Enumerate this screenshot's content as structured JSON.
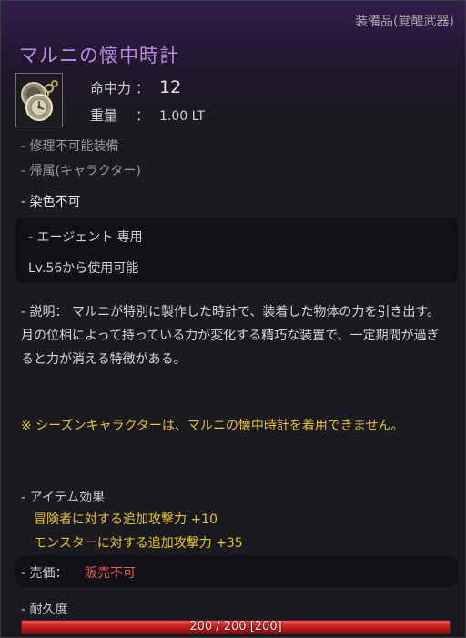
{
  "header": {
    "category": "装備品(覚醒武器)",
    "title": "マルニの懐中時計"
  },
  "icon": {
    "name": "pocket-watch-icon"
  },
  "stats": [
    {
      "label": "命中力",
      "colon": "：",
      "value": "12"
    },
    {
      "label": "重量",
      "colon": "：",
      "value": "1.00 LT"
    }
  ],
  "properties": [
    "- 修理不可能装備",
    "- 帰属(キャラクター)",
    "- 染色不可"
  ],
  "restriction": {
    "class": "- エージェント 専用",
    "level": "Lv.56から使用可能"
  },
  "description": "- 説明： マルニが特別に製作した時計で、装着した物体の力を引き出す。月の位相によって持っている力が変化する精巧な装置で、一定期間が過ぎると力が消える特徴がある。",
  "note": "※ シーズンキャラクターは、マルニの懐中時計を着用できません。",
  "effects": {
    "header": "- アイテム効果",
    "items": [
      "冒険者に対する追加攻撃力 +10",
      "モンスターに対する追加攻撃力 +35"
    ]
  },
  "price": {
    "label": "- 売価：",
    "value": "販売不可"
  },
  "durability": {
    "label": "- 耐久度",
    "text": "200 / 200 [200]",
    "current": 200,
    "max": 200
  },
  "colors": {
    "title": "#b98ae6",
    "highlight": "#e6c234",
    "unsellable": "#e65a5a",
    "durability_bar": "#d42020"
  }
}
